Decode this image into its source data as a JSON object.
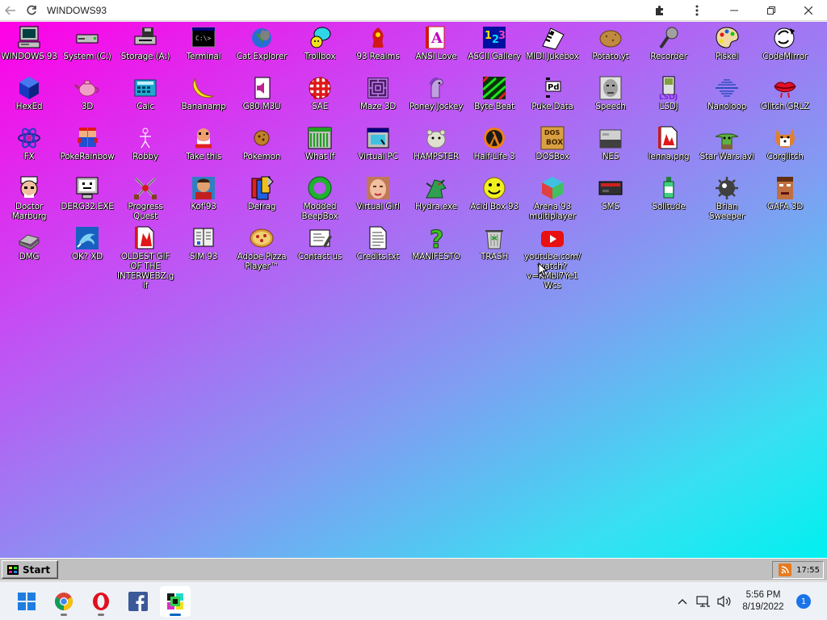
{
  "browser": {
    "title": "WINDOWS93"
  },
  "desktop": {
    "icons": [
      {
        "label": "WINDOWS 93",
        "icon": "computer-icon"
      },
      {
        "label": "System (C:)",
        "icon": "drive-icon"
      },
      {
        "label": "Storage (A:)",
        "icon": "floppy-drive-icon"
      },
      {
        "label": "Terminal",
        "icon": "terminal-icon"
      },
      {
        "label": "Cat Explorer",
        "icon": "cat-globe-icon"
      },
      {
        "label": "Trollbox",
        "icon": "chat-icon"
      },
      {
        "label": "93 Realms",
        "icon": "realms-icon"
      },
      {
        "label": "ANSI Love",
        "icon": "ansi-icon"
      },
      {
        "label": "ASCII Gallery",
        "icon": "ascii-icon"
      },
      {
        "label": "MIDI Jukebox",
        "icon": "piano-icon"
      },
      {
        "label": "Potato.yt",
        "icon": "potato-icon"
      },
      {
        "label": "Recorder",
        "icon": "microphone-icon"
      },
      {
        "label": "Piskel",
        "icon": "palette-icon"
      },
      {
        "label": "CodeMirror",
        "icon": "codemirror-icon"
      },
      {
        "label": "HexEd",
        "icon": "hexed-icon"
      },
      {
        "label": "3D",
        "icon": "teapot-icon"
      },
      {
        "label": "Calc",
        "icon": "calculator-icon"
      },
      {
        "label": "Bananamp",
        "icon": "banana-icon"
      },
      {
        "label": "G80.M3U",
        "icon": "speaker-icon"
      },
      {
        "label": "SAE",
        "icon": "ball-icon"
      },
      {
        "label": "Maze 3D",
        "icon": "maze-icon"
      },
      {
        "label": "Poney Jockey",
        "icon": "pony-icon"
      },
      {
        "label": "Byte Beat",
        "icon": "bytebeat-icon"
      },
      {
        "label": "Puke Data",
        "icon": "puredata-icon"
      },
      {
        "label": "Speech",
        "icon": "face-icon"
      },
      {
        "label": "LSDJ",
        "icon": "gameboy-icon"
      },
      {
        "label": "Nanoloop",
        "icon": "waveform-icon"
      },
      {
        "label": "Glitch GRLZ",
        "icon": "lips-icon"
      },
      {
        "label": "FX",
        "icon": "atom-icon"
      },
      {
        "label": "PokeRainbow",
        "icon": "mario-icon"
      },
      {
        "label": "Robby",
        "icon": "stickman-icon"
      },
      {
        "label": "Take this",
        "icon": "old-man-icon"
      },
      {
        "label": "Pokemon",
        "icon": "cookie-icon"
      },
      {
        "label": "What If",
        "icon": "window-icon"
      },
      {
        "label": "Virtual PC",
        "icon": "window-pc-icon"
      },
      {
        "label": "HAMPSTER",
        "icon": "hamster-icon"
      },
      {
        "label": "Half-Life 3",
        "icon": "halflife-icon"
      },
      {
        "label": "DOSBox",
        "icon": "dosbox-icon"
      },
      {
        "label": "NES",
        "icon": "nes-icon"
      },
      {
        "label": "lenna.png",
        "icon": "image-file-icon"
      },
      {
        "label": "Star Wars.avi",
        "icon": "yoda-icon"
      },
      {
        "label": "Corglitch",
        "icon": "corgi-icon"
      },
      {
        "label": "Doctor Marburg",
        "icon": "doctor-icon"
      },
      {
        "label": "DERG32.EXE",
        "icon": "monitor-face-icon"
      },
      {
        "label": "Progress Quest",
        "icon": "swords-icon"
      },
      {
        "label": "Kof'93",
        "icon": "fighter-icon"
      },
      {
        "label": "Defrag",
        "icon": "defrag-icon"
      },
      {
        "label": "Modded BeepBox",
        "icon": "ring-icon"
      },
      {
        "label": "Virtual Girl",
        "icon": "girl-face-icon"
      },
      {
        "label": "Hydra.exe",
        "icon": "dragon-icon"
      },
      {
        "label": "Acid Box 93",
        "icon": "smiley-icon"
      },
      {
        "label": "Arena 93 multiplayer",
        "icon": "cube-icon"
      },
      {
        "label": "SMS",
        "icon": "console-icon"
      },
      {
        "label": "Solitude",
        "icon": "bottle-icon"
      },
      {
        "label": "Brian Sweeper",
        "icon": "mine-icon"
      },
      {
        "label": "GAFA 3D",
        "icon": "doomguy-icon"
      },
      {
        "label": "DMG",
        "icon": "disk-image-icon"
      },
      {
        "label": "OK? XD",
        "icon": "dolphin-icon"
      },
      {
        "label": "OLDEST GIF OF THE INTERWEBZ.gif",
        "icon": "gif-file-icon"
      },
      {
        "label": "SIM 93",
        "icon": "book-icon"
      },
      {
        "label": "Adobe Pizza Player™",
        "icon": "pizza-icon"
      },
      {
        "label": "Contact us",
        "icon": "contact-icon"
      },
      {
        "label": "Credits.txt",
        "icon": "text-file-icon"
      },
      {
        "label": "MANIFESTO",
        "icon": "question-icon"
      },
      {
        "label": "TRASH",
        "icon": "trash-icon"
      },
      {
        "label": "youtube.com/watch?v=KMbl7Ye1Wcs",
        "icon": "youtube-icon"
      }
    ]
  },
  "w93_taskbar": {
    "start_label": "Start",
    "clock": "17:55"
  },
  "win_taskbar": {
    "apps": [
      "windows-start-icon",
      "chrome-icon",
      "opera-icon",
      "facebook-icon",
      "windows93-icon"
    ],
    "time": "5:56 PM",
    "date": "8/19/2022",
    "notifications": "1"
  }
}
